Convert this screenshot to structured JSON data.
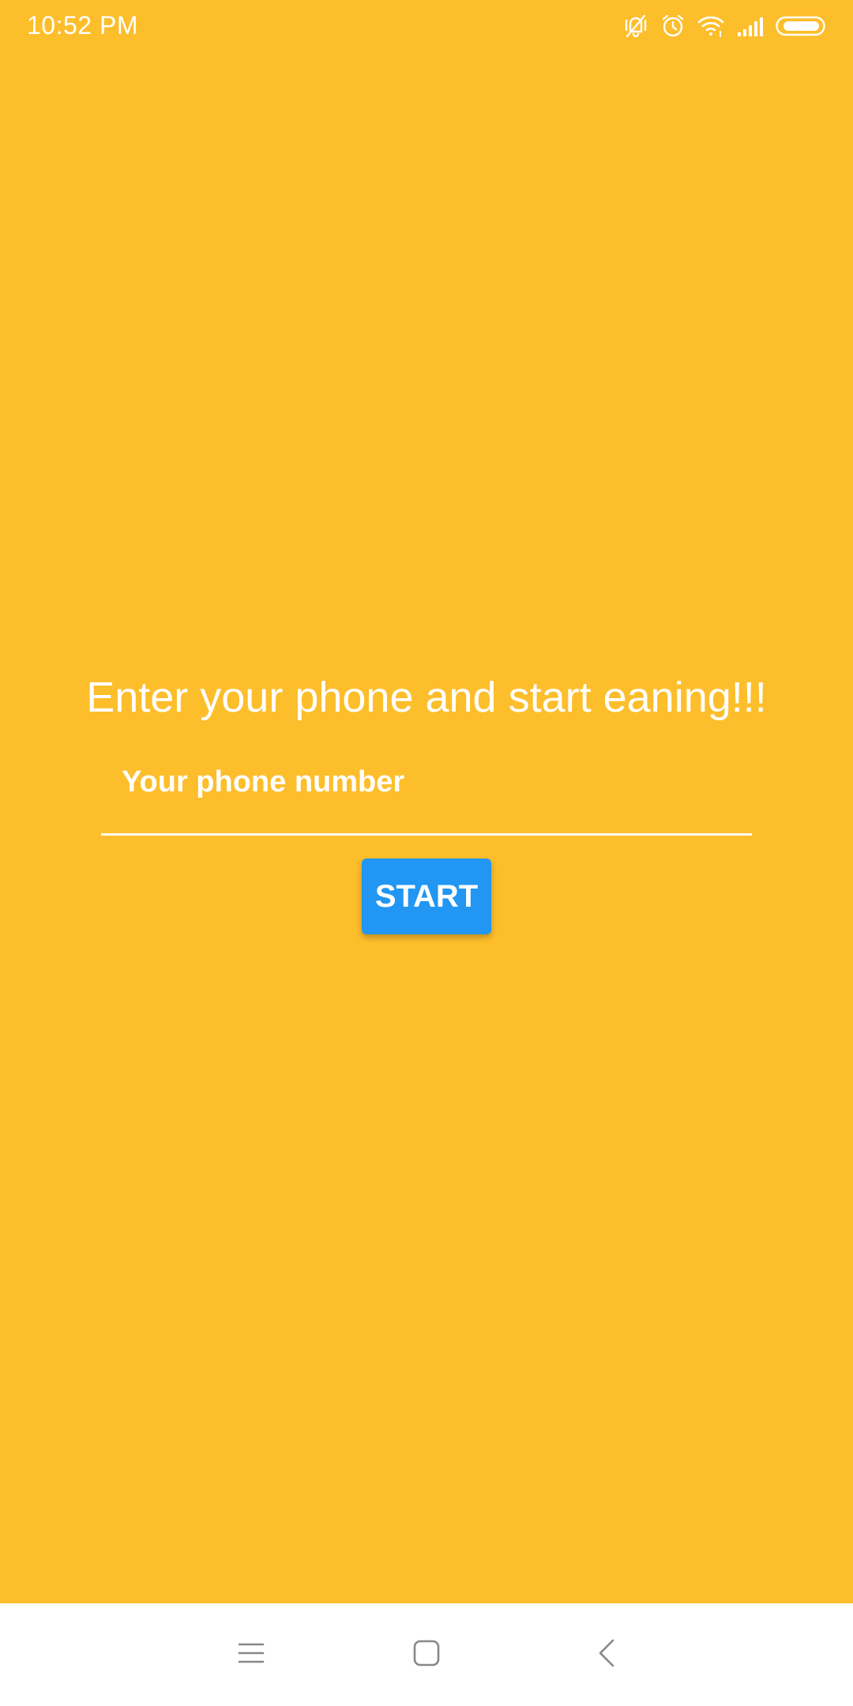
{
  "status_bar": {
    "time": "10:52  PM",
    "icons": [
      "vibrate-off-icon",
      "alarm-icon",
      "wifi-icon",
      "signal-icon",
      "battery-icon"
    ]
  },
  "main": {
    "headline": "Enter your phone and start eaning!!!",
    "phone_input": {
      "placeholder": "Your phone number",
      "value": ""
    },
    "start_label": "START"
  },
  "nav_bar": {
    "icons": [
      "menu-icon",
      "home-icon",
      "back-icon"
    ]
  },
  "colors": {
    "background": "#FDBE2B",
    "accent": "#2196F3",
    "text": "#FFFFFF",
    "nav_background": "#FFFFFF",
    "nav_icon": "#888888"
  }
}
